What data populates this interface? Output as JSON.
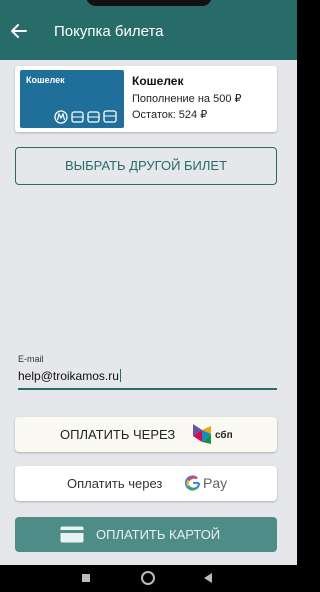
{
  "appbar": {
    "title": "Покупка билета"
  },
  "ticket": {
    "image_label": "Кошелек",
    "name": "Кошелек",
    "topup": "Пополнение на 500 ₽",
    "balance": "Остаток: 524 ₽"
  },
  "choose_button_label": "ВЫБРАТЬ ДРУГОЙ БИЛЕТ",
  "email": {
    "label": "E-mail",
    "value": "help@troikamos.ru"
  },
  "pay_sbp": {
    "label": "ОПЛАТИТЬ ЧЕРЕЗ",
    "logo_text": "сбп"
  },
  "pay_gpay": {
    "label": "Оплатить через",
    "logo_text": "Pay"
  },
  "pay_card": {
    "label": "ОПЛАТИТЬ КАРТОЙ"
  },
  "colors": {
    "primary": "#286c6a",
    "card_button": "#4e8c88",
    "background": "#e6e7ea"
  }
}
